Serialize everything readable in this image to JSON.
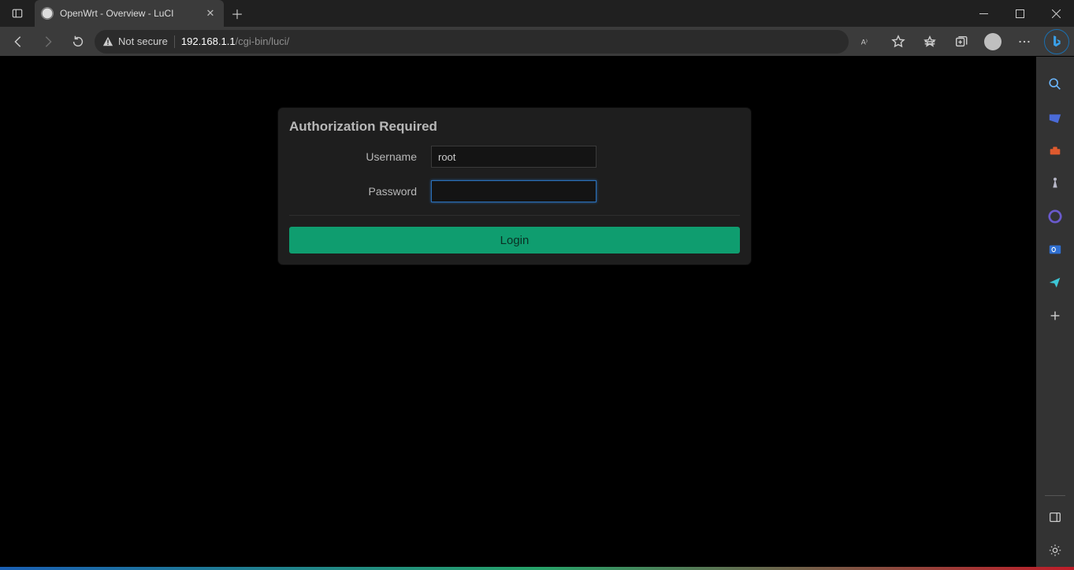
{
  "browser": {
    "tab_title": "OpenWrt - Overview - LuCI",
    "not_secure_label": "Not secure",
    "url_host": "192.168.1.1",
    "url_path": "/cgi-bin/luci/"
  },
  "login": {
    "title": "Authorization Required",
    "username_label": "Username",
    "username_value": "root",
    "password_label": "Password",
    "password_value": "",
    "button_label": "Login"
  }
}
